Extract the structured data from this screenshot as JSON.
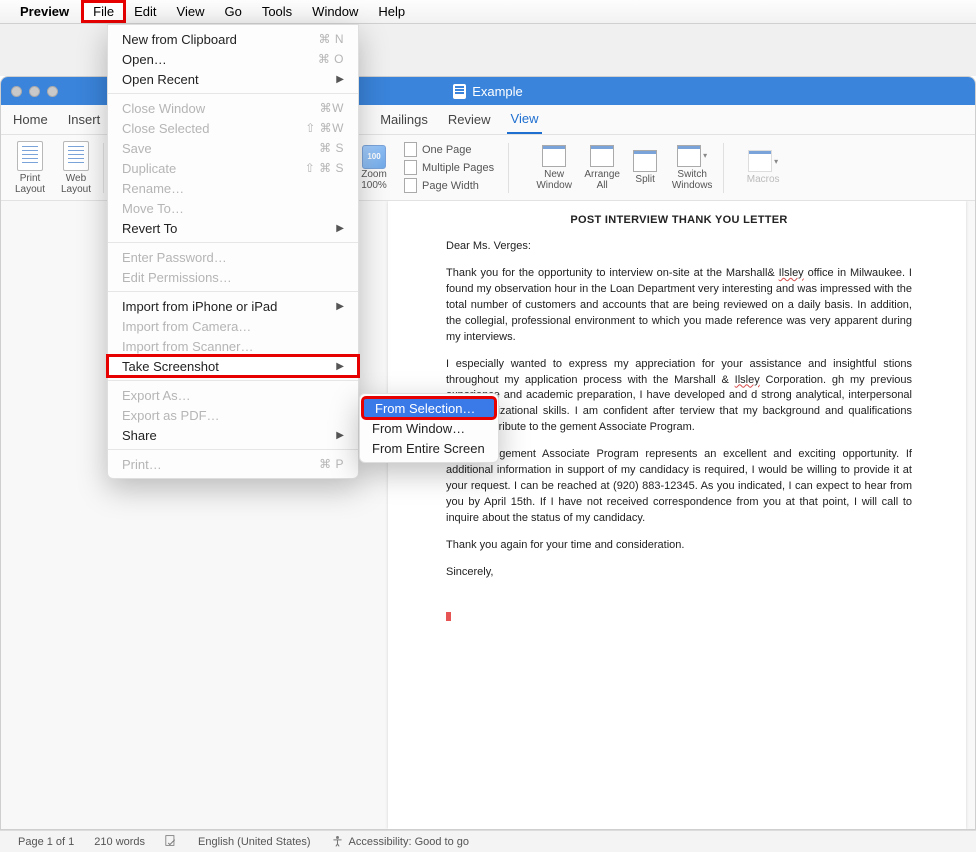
{
  "mac_menu": {
    "app_name": "Preview",
    "items": [
      "File",
      "Edit",
      "View",
      "Go",
      "Tools",
      "Window",
      "Help"
    ]
  },
  "file_menu": {
    "groups": [
      [
        {
          "label": "New from Clipboard",
          "sc": "⌘ N",
          "disabled": false
        },
        {
          "label": "Open…",
          "sc": "⌘ O",
          "disabled": false
        },
        {
          "label": "Open Recent",
          "sub": true,
          "disabled": false
        }
      ],
      [
        {
          "label": "Close Window",
          "sc": "⌘W",
          "disabled": true
        },
        {
          "label": "Close Selected",
          "sc": "⇧ ⌘W",
          "disabled": true
        },
        {
          "label": "Save",
          "sc": "⌘ S",
          "disabled": true
        },
        {
          "label": "Duplicate",
          "sc": "⇧ ⌘ S",
          "disabled": true
        },
        {
          "label": "Rename…",
          "disabled": true
        },
        {
          "label": "Move To…",
          "disabled": true
        },
        {
          "label": "Revert To",
          "sub": true,
          "disabled": false
        }
      ],
      [
        {
          "label": "Enter Password…",
          "disabled": true
        },
        {
          "label": "Edit Permissions…",
          "disabled": true
        }
      ],
      [
        {
          "label": "Import from iPhone or iPad",
          "sub": true,
          "disabled": false
        },
        {
          "label": "Import from Camera…",
          "disabled": true
        },
        {
          "label": "Import from Scanner…",
          "disabled": true
        },
        {
          "label": "Take Screenshot",
          "sub": true,
          "disabled": false,
          "hi": true
        }
      ],
      [
        {
          "label": "Export As…",
          "disabled": true
        },
        {
          "label": "Export as PDF…",
          "disabled": true
        },
        {
          "label": "Share",
          "sub": true,
          "disabled": false
        }
      ],
      [
        {
          "label": "Print…",
          "sc": "⌘ P",
          "disabled": true
        }
      ]
    ]
  },
  "submenu": {
    "items": [
      {
        "label": "From Selection…",
        "hi": true
      },
      {
        "label": "From Window…"
      },
      {
        "label": "From Entire Screen"
      }
    ]
  },
  "window": {
    "title": "Example"
  },
  "ribbon_tabs": [
    "Home",
    "Insert",
    "Mailings",
    "Review",
    "View"
  ],
  "ribbon": {
    "print_layout": "Print Layout",
    "web_layout": "Web Layout",
    "zoom": "Zoom",
    "zoom_pct": "100%",
    "zoom_badge": "100",
    "one_page": "One Page",
    "multiple_pages": "Multiple Pages",
    "page_width": "Page Width",
    "new_window": "New Window",
    "arrange_all": "Arrange All",
    "split": "Split",
    "switch_windows": "Switch Windows",
    "macros": "Macros"
  },
  "document": {
    "title": "POST INTERVIEW THANK YOU LETTER",
    "greeting": "Dear Ms. Verges:",
    "p1a": "Thank you for the opportunity to interview on-site at the Marshall& ",
    "p1_sq": "Ilsley",
    "p1b": " office in Milwaukee. I found my observation hour in the Loan Department very interesting and was impressed with the total number of customers and accounts that are being reviewed on a daily basis. In addition, the collegial, professional environment to which you made reference was very apparent during my interviews.",
    "p2a": "I especially wanted to express my appreciation for your assistance and insightful stions throughout my application process with the Marshall & ",
    "p2_sq": "Ilsley",
    "p2b": " Corporation. gh my previous experience and academic preparation, I have developed and d strong analytical, interpersonal and organizational skills. I am confident after terview that my background and qualifications would contribute to the gement Associate Program.",
    "p3": "The Management Associate Program represents an excellent and exciting opportunity. If additional information in support of my candidacy is required, I would be willing to provide it at your request. I can be reached at (920) 883-12345. As you indicated, I can expect to hear from you by April 15th. If I have not received correspondence from you at that point, I will call to inquire about the status of my candidacy.",
    "p4": "Thank you again for your time and consideration.",
    "closing": "Sincerely,"
  },
  "status": {
    "page": "Page 1 of 1",
    "words": "210 words",
    "lang": "English (United States)",
    "access": "Accessibility: Good to go"
  }
}
